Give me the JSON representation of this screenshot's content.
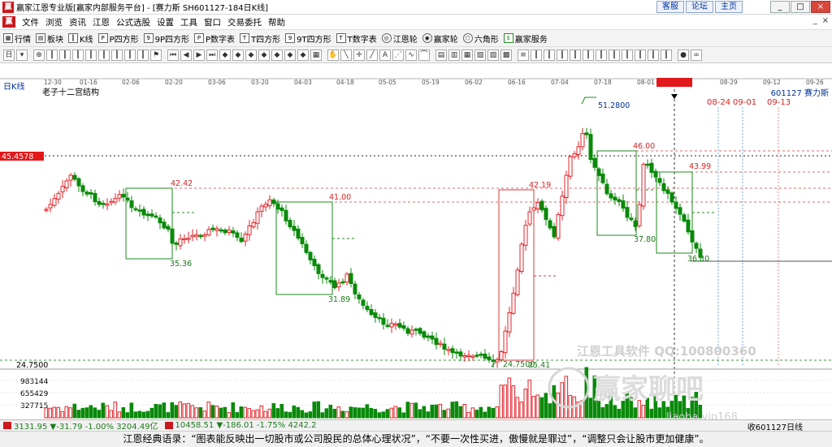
{
  "window": {
    "title": "赢家江恩专业版[赢家内部服务平台] - [赛力斯  SH601127-184日K线]",
    "links": [
      "客服",
      "论坛",
      "主页"
    ],
    "controls": [
      "_",
      "□",
      "×"
    ]
  },
  "menu": {
    "items": [
      "文件",
      "浏览",
      "资讯",
      "江恩",
      "公式选股",
      "设置",
      "工具",
      "窗口",
      "交易委托",
      "帮助"
    ],
    "right": [
      "_",
      "×"
    ]
  },
  "toolbar1": {
    "items": [
      {
        "label": "行情",
        "icon": "grid-icon"
      },
      {
        "label": "板块",
        "icon": "block-icon"
      },
      {
        "label": "K线",
        "icon": "kline-icon"
      },
      {
        "label": "P四方形",
        "icon": "p-square-icon"
      },
      {
        "label": "9P四方形",
        "icon": "9p-square-icon"
      },
      {
        "label": "P数字表",
        "icon": "p-table-icon"
      },
      {
        "label": "T四方形",
        "icon": "t-square-icon"
      },
      {
        "label": "9T四方形",
        "icon": "9t-square-icon"
      },
      {
        "label": "T数字表",
        "icon": "t-table-icon"
      },
      {
        "label": "江恩轮",
        "icon": "gann-wheel-icon"
      },
      {
        "label": "赢家轮",
        "icon": "winner-wheel-icon"
      },
      {
        "label": "六角形",
        "icon": "hexagon-icon"
      },
      {
        "label": "赢家服务",
        "icon": "dollar-icon"
      }
    ]
  },
  "chart": {
    "period_label": "日K线",
    "stock_code_name": "601127  赛力斯",
    "structure_label": "老子十二宫结构",
    "current_price_label": "45.4578",
    "cursor_date": "2023-08-10",
    "future_dates": [
      "08-24",
      "09-01",
      "09-13"
    ],
    "date_ticks": [
      "12-30",
      "01-16",
      "02-06",
      "02-20",
      "03-06",
      "03-20",
      "04-03",
      "04-18",
      "05-05",
      "05-19",
      "06-02",
      "06-16",
      "07-04",
      "07-18",
      "08-01",
      "2023-08-10",
      "08-29",
      "09-12",
      "09-26"
    ],
    "price_annotations": [
      "42.42",
      "35.36",
      "41.00",
      "31.89",
      "42.19",
      "24.7500",
      "25.41",
      "51.2800",
      "46.00",
      "37.80",
      "43.99",
      "36.30"
    ],
    "low_price_label": "24.7500",
    "volume_ticks": [
      "983144",
      "655429",
      "327715"
    ],
    "watermark_text": [
      "江恩工具软件  QQ:100800360",
      "赢家聊吧",
      "liaoba.vip168"
    ],
    "colors": {
      "up": "#e0262b",
      "down": "#0a8a0a",
      "box_green": "#1c8a1c",
      "box_red": "#d63b3b",
      "price_tag_bg": "#e3181a"
    }
  },
  "chart_data": {
    "type": "candlestick",
    "title": "赛力斯  SH601127-184日K线",
    "annotations": [
      {
        "label": "42.42"
      },
      {
        "label": "35.36"
      },
      {
        "label": "41.00"
      },
      {
        "label": "31.89"
      },
      {
        "label": "42.19"
      },
      {
        "label": "24.7500"
      },
      {
        "label": "25.41"
      },
      {
        "label": "51.2800"
      },
      {
        "label": "46.00"
      },
      {
        "label": "37.80"
      },
      {
        "label": "43.99"
      },
      {
        "label": "36.30"
      }
    ],
    "current_price": 45.4578,
    "ylim": [
      24.75,
      51.28
    ],
    "date_ticks": [
      "12-30",
      "01-16",
      "02-06",
      "02-20",
      "03-06",
      "03-20",
      "04-03",
      "04-18",
      "05-05",
      "05-19",
      "06-02",
      "06-16",
      "07-04",
      "07-18",
      "08-01",
      "2023-08-10",
      "08-29",
      "09-12",
      "09-26"
    ],
    "volume_ticks": [
      983144,
      655429,
      327715
    ],
    "legend": "none",
    "grid": false
  },
  "bottom": {
    "index1": "3131.95  ▼-31.79  -1.00%  3204.49亿",
    "index2": "10458.51  ▼-186.01  -1.75%  4242.2",
    "right_label": "收601127日线"
  },
  "footer": {
    "quote": "江恩经典语录：“图表能反映出一切股市或公司股民的总体心理状况”，“不要一次性买进，傲慢就是罪过”，“调整只会让股市更加健康”。"
  }
}
